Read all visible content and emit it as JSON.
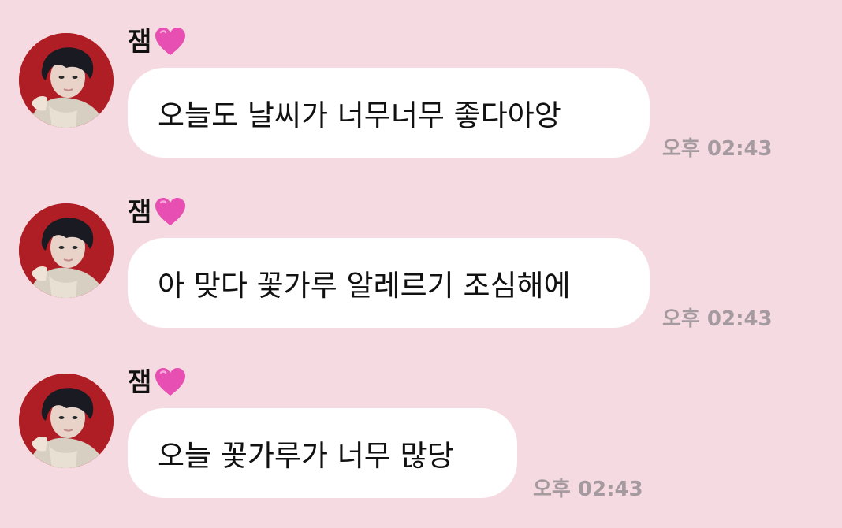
{
  "messages": [
    {
      "sender": "잼",
      "sender_emoji": "heart-icon",
      "text": "오늘도 날씨가 너무너무 좋다아앙",
      "time": "오후 02:43"
    },
    {
      "sender": "잼",
      "sender_emoji": "heart-icon",
      "text": "아 맞다 꽃가루 알레르기 조심해에",
      "time": "오후 02:43"
    },
    {
      "sender": "잼",
      "sender_emoji": "heart-icon",
      "text": "오늘 꽃가루가 너무 많당",
      "time": "오후 02:43"
    }
  ],
  "colors": {
    "background": "#f5dbe1",
    "bubble": "#ffffff",
    "timestamp": "#a59aa0",
    "heart": "#e84fb3",
    "avatar_bg": "#b01e25"
  }
}
